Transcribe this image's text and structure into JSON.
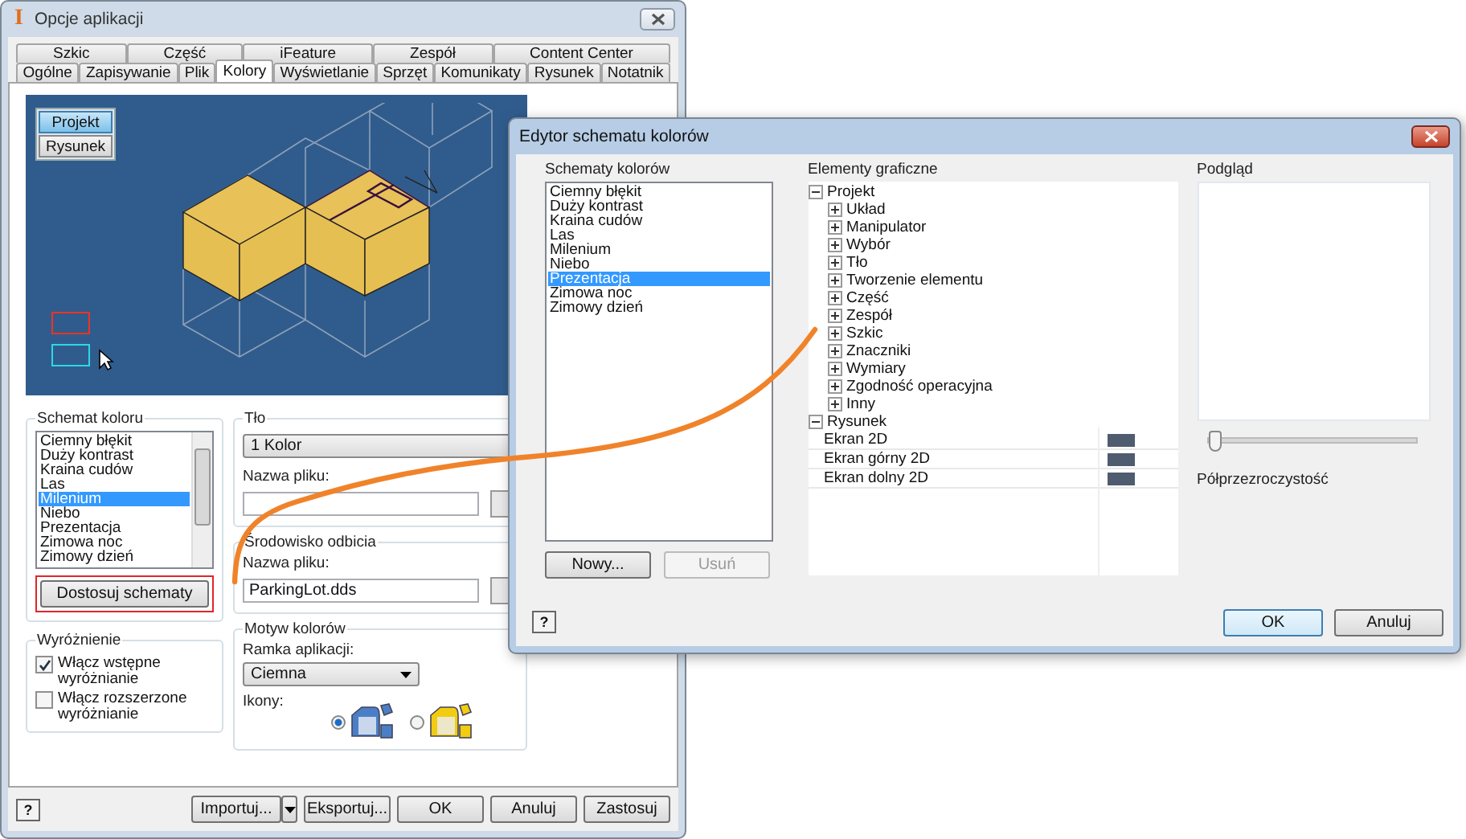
{
  "options_window": {
    "app_logo": "I",
    "title": "Opcje aplikacji",
    "tab_rows": [
      [
        {
          "label": "Szkic",
          "selected": false
        },
        {
          "label": "Część",
          "selected": false
        },
        {
          "label": "iFeature",
          "selected": false
        },
        {
          "label": "Zespół",
          "selected": false
        },
        {
          "label": "Content Center",
          "selected": false
        }
      ],
      [
        {
          "label": "Ogólne",
          "selected": false
        },
        {
          "label": "Zapisywanie",
          "selected": false
        },
        {
          "label": "Plik",
          "selected": false
        },
        {
          "label": "Kolory",
          "selected": true
        },
        {
          "label": "Wyświetlanie",
          "selected": false
        },
        {
          "label": "Sprzęt",
          "selected": false
        },
        {
          "label": "Komunikaty",
          "selected": false
        },
        {
          "label": "Rysunek",
          "selected": false
        },
        {
          "label": "Notatnik",
          "selected": false
        }
      ]
    ],
    "preview_buttons": [
      {
        "label": "Projekt",
        "selected": true
      },
      {
        "label": "Rysunek",
        "selected": false
      }
    ],
    "color_scheme": {
      "title": "Schemat koloru",
      "items": [
        {
          "label": "Ciemny błękit",
          "selected": false
        },
        {
          "label": "Duży kontrast",
          "selected": false
        },
        {
          "label": "Kraina cudów",
          "selected": false
        },
        {
          "label": "Las",
          "selected": false
        },
        {
          "label": "Milenium",
          "selected": true
        },
        {
          "label": "Niebo",
          "selected": false
        },
        {
          "label": "Prezentacja",
          "selected": false
        },
        {
          "label": "Zimowa noc",
          "selected": false
        },
        {
          "label": "Zimowy dzień",
          "selected": false
        }
      ],
      "customize_button": "Dostosuj schematy"
    },
    "highlight": {
      "title": "Wyróżnienie",
      "options": [
        {
          "label": "Włącz wstępne wyróżnianie",
          "checked": true
        },
        {
          "label": "Włącz rozszerzone wyróżnianie",
          "checked": false
        }
      ]
    },
    "background": {
      "title": "Tło",
      "dropdown": "1 Kolor",
      "file_label": "Nazwa pliku:"
    },
    "reflection": {
      "title": "Środowisko odbicia",
      "file_label": "Nazwa pliku:",
      "file_value": "ParkingLot.dds"
    },
    "color_theme": {
      "title": "Motyw kolorów",
      "frame_label": "Ramka aplikacji:",
      "frame_value": "Ciemna",
      "icons_label": "Ikony:",
      "icon_options": [
        {
          "color": "#4a7fc8",
          "selected": true
        },
        {
          "color": "#f2cc10",
          "selected": false
        }
      ]
    },
    "help_button": "?",
    "buttons": [
      {
        "label": "Importuj...",
        "kind": "split"
      },
      {
        "label": "Eksportuj...",
        "kind": "plain"
      },
      {
        "label": "OK",
        "kind": "plain"
      },
      {
        "label": "Anuluj",
        "kind": "plain"
      },
      {
        "label": "Zastosuj",
        "kind": "plain"
      }
    ]
  },
  "editor_window": {
    "title": "Edytor schematu kolorów",
    "schemes_label": "Schematy kolorów",
    "schemes": [
      {
        "label": "Ciemny błękit",
        "selected": false
      },
      {
        "label": "Duży kontrast",
        "selected": false
      },
      {
        "label": "Kraina cudów",
        "selected": false
      },
      {
        "label": "Las",
        "selected": false
      },
      {
        "label": "Milenium",
        "selected": false
      },
      {
        "label": "Niebo",
        "selected": false
      },
      {
        "label": "Prezentacja",
        "selected": true
      },
      {
        "label": "Zimowa noc",
        "selected": false
      },
      {
        "label": "Zimowy dzień",
        "selected": false
      }
    ],
    "new_button": {
      "label": "Nowy...",
      "disabled": false
    },
    "delete_button": {
      "label": "Usuń",
      "disabled": true
    },
    "elements_label": "Elementy graficzne",
    "tree": [
      {
        "label": "Projekt",
        "expanded": true,
        "children": [
          {
            "label": "Układ",
            "expanded": false
          },
          {
            "label": "Manipulator",
            "expanded": false
          },
          {
            "label": "Wybór",
            "expanded": false
          },
          {
            "label": "Tło",
            "expanded": false
          },
          {
            "label": "Tworzenie elementu",
            "expanded": false
          },
          {
            "label": "Część",
            "expanded": false
          },
          {
            "label": "Zespół",
            "expanded": false
          },
          {
            "label": "Szkic",
            "expanded": false
          },
          {
            "label": "Znaczniki",
            "expanded": false
          },
          {
            "label": "Wymiary",
            "expanded": false
          },
          {
            "label": "Zgodność operacyjna",
            "expanded": false
          },
          {
            "label": "Inny",
            "expanded": false
          }
        ]
      },
      {
        "label": "Rysunek",
        "expanded": true,
        "children": [
          {
            "label": "Ekran 2D",
            "color": "#4f5b6e"
          },
          {
            "label": "Ekran górny 2D",
            "color": "#4f5b6e"
          },
          {
            "label": "Ekran dolny 2D",
            "color": "#4f5b6e"
          }
        ]
      }
    ],
    "preview_label": "Podgląd",
    "transparency": {
      "label": "Półprzezroczystość",
      "level": 0
    },
    "help_button": "?",
    "ok_button": "OK",
    "cancel_button": "Anuluj"
  }
}
